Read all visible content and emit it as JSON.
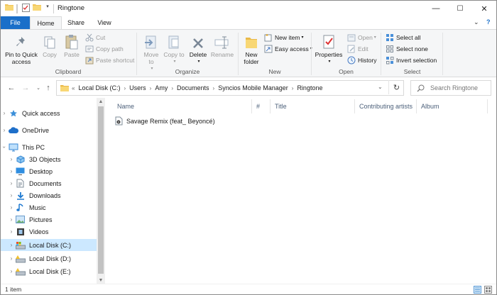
{
  "window": {
    "title": "Ringtone",
    "controls": {
      "minimize": "—",
      "maximize": "☐",
      "close": "✕"
    }
  },
  "tabs": {
    "file": "File",
    "home": "Home",
    "share": "Share",
    "view": "View",
    "collapse_chevron": "⌄",
    "help": "?"
  },
  "ribbon": {
    "clipboard": {
      "label": "Clipboard",
      "pin": "Pin to Quick access",
      "copy": "Copy",
      "paste": "Paste",
      "cut": "Cut",
      "copy_path": "Copy path",
      "paste_shortcut": "Paste shortcut"
    },
    "organize": {
      "label": "Organize",
      "move_to": "Move to",
      "copy_to": "Copy to",
      "delete": "Delete",
      "rename": "Rename"
    },
    "new": {
      "label": "New",
      "new_folder": "New folder",
      "new_item": "New item",
      "easy_access": "Easy access"
    },
    "open": {
      "label": "Open",
      "properties": "Properties",
      "open": "Open",
      "edit": "Edit",
      "history": "History"
    },
    "select": {
      "label": "Select",
      "select_all": "Select all",
      "select_none": "Select none",
      "invert_selection": "Invert selection"
    }
  },
  "address": {
    "overflow": "«",
    "crumbs": [
      "Local Disk (C:)",
      "Users",
      "Amy",
      "Documents",
      "Syncios Mobile Manager",
      "Ringtone"
    ],
    "dropdown": "⌄",
    "search_placeholder": "Search Ringtone"
  },
  "nav_pane": {
    "quick_access": "Quick access",
    "onedrive": "OneDrive",
    "this_pc": "This PC",
    "items": [
      "3D Objects",
      "Desktop",
      "Documents",
      "Downloads",
      "Music",
      "Pictures",
      "Videos",
      "Local Disk (C:)",
      "Local Disk (D:)",
      "Local Disk (E:)"
    ]
  },
  "file_list": {
    "columns": {
      "name": "Name",
      "number": "#",
      "title": "Title",
      "artists": "Contributing artists",
      "album": "Album"
    },
    "files": [
      {
        "name": "Savage Remix (feat_ Beyoncé)"
      }
    ]
  },
  "status": {
    "text": "1 item"
  },
  "colors": {
    "accent": "#1a6fc9",
    "selection": "#cce8ff",
    "folder": "#f2c55c"
  }
}
